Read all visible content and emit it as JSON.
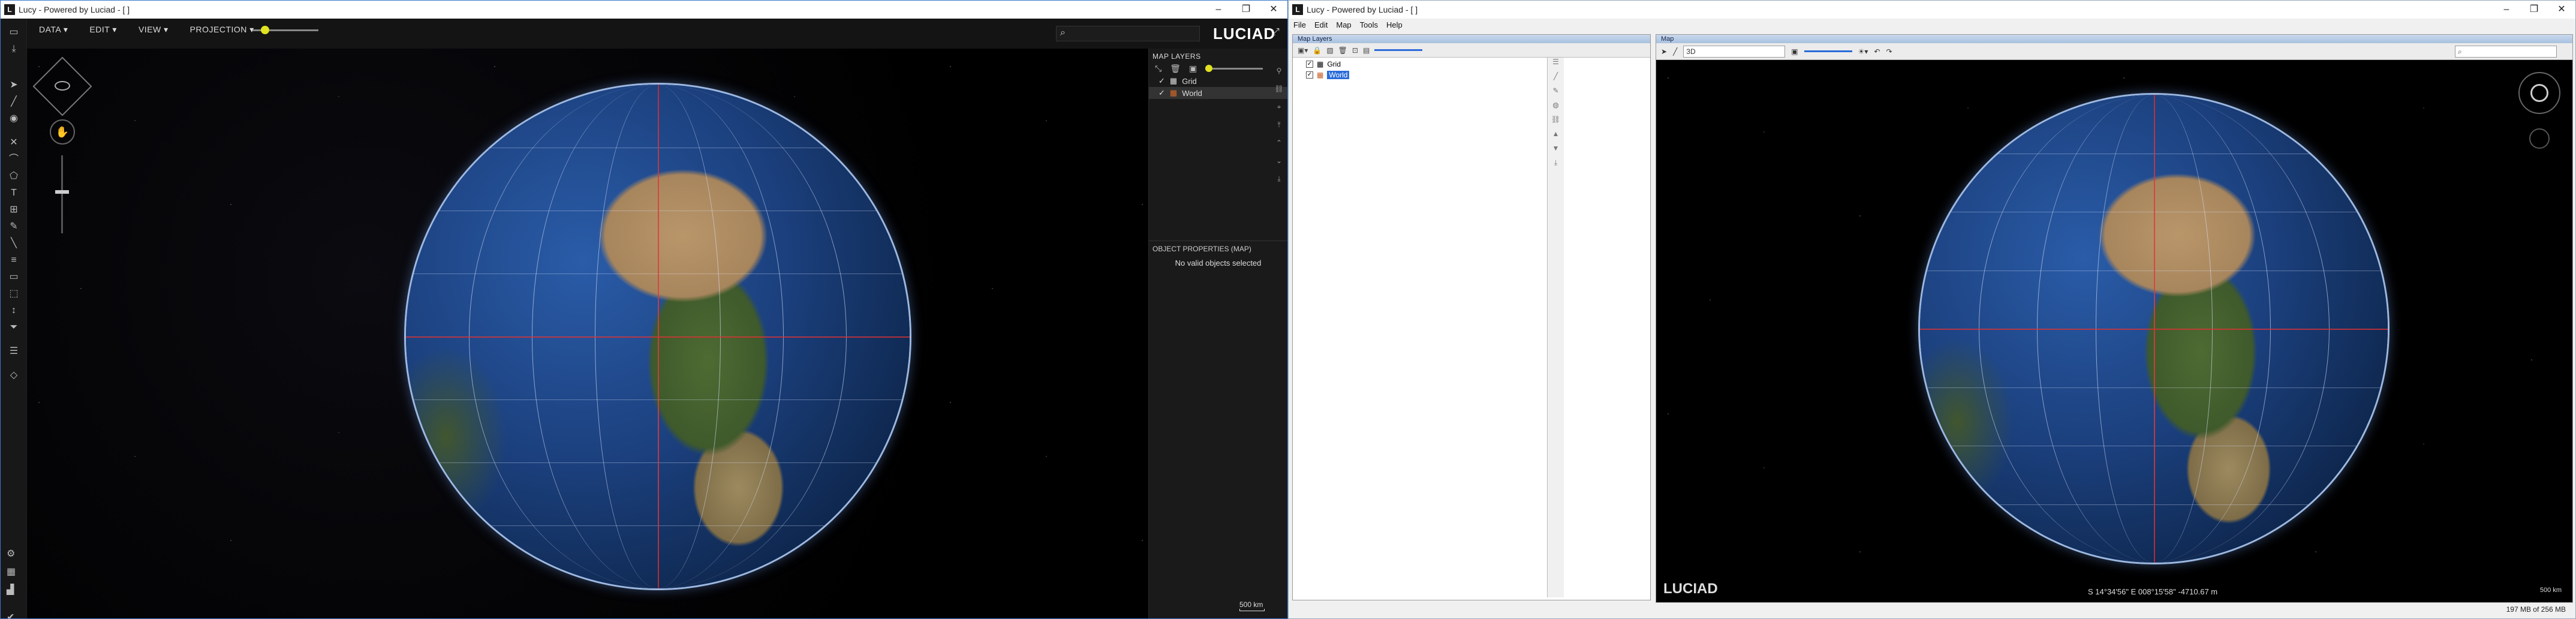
{
  "left_window": {
    "title": "Lucy - Powered by Luciad - [ ]",
    "menu": [
      "DATA ▾",
      "EDIT ▾",
      "VIEW ▾",
      "PROJECTION ▾"
    ],
    "brand": "LUCIAD",
    "search_placeholder": "",
    "map_layers": {
      "heading": "MAP LAYERS",
      "layers": [
        {
          "name": "Grid",
          "checked": true
        },
        {
          "name": "World",
          "checked": true,
          "selected": true
        }
      ]
    },
    "object_properties": {
      "heading": "OBJECT PROPERTIES (MAP)",
      "message": "No valid objects selected"
    },
    "scale_label": "500 km"
  },
  "right_window": {
    "title": "Lucy - Powered by Luciad - [ ]",
    "menubar": [
      "File",
      "Edit",
      "Map",
      "Tools",
      "Help"
    ],
    "map_layers_pane": {
      "title": "Map Layers",
      "layers": [
        {
          "name": "Grid",
          "checked": true
        },
        {
          "name": "World",
          "checked": true,
          "selected": true
        }
      ]
    },
    "map_pane": {
      "title": "Map",
      "projection": "3D",
      "brand": "LUCIAD",
      "coordinates": "S 14°34'56\" E 008°15'58\"  -4710.67 m",
      "scale_label": "500 km"
    },
    "memory_status": "197 MB of 256 MB"
  },
  "window_controls": [
    "–",
    "❐",
    "✕"
  ],
  "colors": {
    "accent_yellow": "#e1e31f",
    "selection_blue": "#2b6bd8",
    "grid_red": "#dc2828",
    "globe_halo": "#b4d2ff"
  }
}
